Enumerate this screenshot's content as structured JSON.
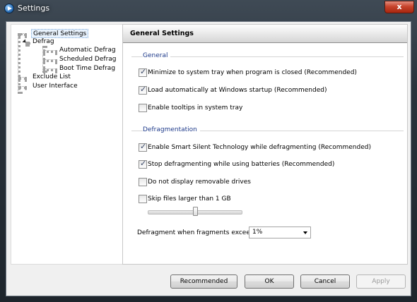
{
  "window": {
    "title": "Settings",
    "close_label": "x"
  },
  "tree": {
    "items": [
      {
        "label": "General Settings"
      },
      {
        "label": "Defrag"
      },
      {
        "label": "Automatic Defrag"
      },
      {
        "label": "Scheduled Defrag"
      },
      {
        "label": "Boot Time Defrag"
      },
      {
        "label": "Exclude List"
      },
      {
        "label": "User Interface"
      }
    ],
    "selected": "General Settings"
  },
  "panel": {
    "title": "General Settings",
    "groups": {
      "general": {
        "label": "General",
        "options": [
          {
            "label": "Minimize to system tray when program is closed (Recommended)",
            "checked": true
          },
          {
            "label": "Load automatically at Windows startup (Recommended)",
            "checked": true
          },
          {
            "label": "Enable tooltips in system tray",
            "checked": false
          }
        ]
      },
      "defrag": {
        "label": "Defragmentation",
        "options": [
          {
            "label": "Enable Smart Silent Technology while defragmenting (Recommended)",
            "checked": true
          },
          {
            "label": "Stop defragmenting while using batteries (Recommended)",
            "checked": true
          },
          {
            "label": "Do not display removable drives",
            "checked": false
          },
          {
            "label": "Skip files larger than 1 GB",
            "checked": false
          }
        ]
      }
    },
    "slider": {
      "fraction": 0.5
    },
    "fragments": {
      "label": "Defragment when fragments exceed:",
      "value": "1%"
    }
  },
  "buttons": {
    "recommended": "Recommended",
    "ok": "OK",
    "cancel": "Cancel",
    "apply": "Apply"
  }
}
